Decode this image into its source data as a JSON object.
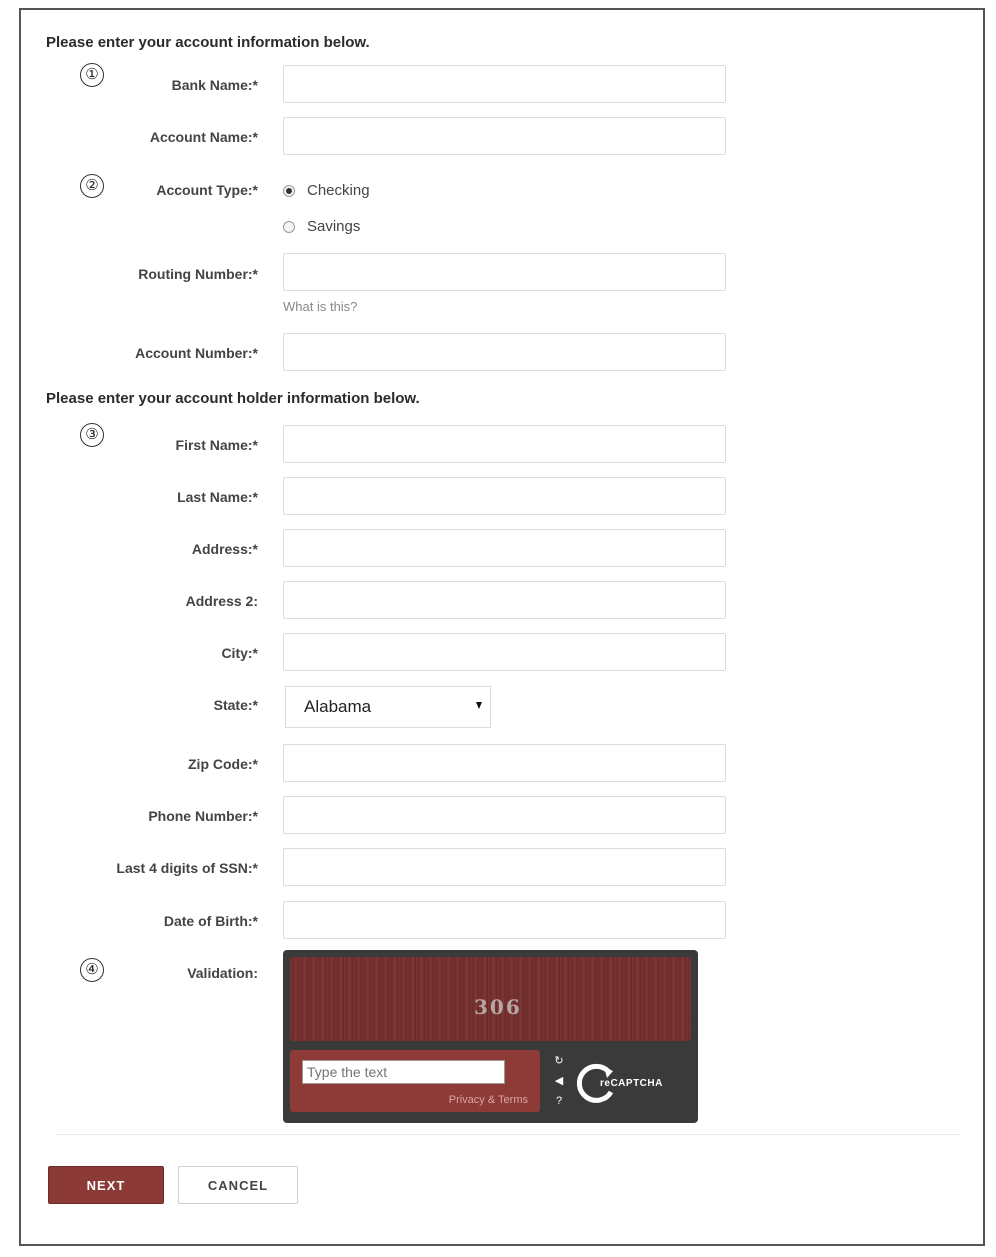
{
  "headings": {
    "account": "Please enter your account information below.",
    "holder": "Please enter your account holder information below."
  },
  "steps": [
    "①",
    "②",
    "③",
    "④"
  ],
  "bank": {
    "bank_name_label": "Bank Name:*",
    "account_name_label": "Account Name:*",
    "account_type_label": "Account Type:*",
    "account_type_options": [
      "Checking",
      "Savings"
    ],
    "account_type_selected": "Checking",
    "routing_label": "Routing Number:*",
    "routing_help": "What is this?",
    "account_number_label": "Account Number:*"
  },
  "holder": {
    "first_name_label": "First Name:*",
    "last_name_label": "Last Name:*",
    "address_label": "Address:*",
    "address2_label": "Address 2:",
    "city_label": "City:*",
    "state_label": "State:*",
    "state_value": "Alabama",
    "zip_label": "Zip Code:*",
    "phone_label": "Phone Number:*",
    "ssn_label": "Last 4 digits of SSN:*",
    "dob_label": "Date of Birth:*",
    "validation_label": "Validation:"
  },
  "captcha": {
    "word": "306",
    "placeholder": "Type the text",
    "terms": "Privacy & Terms",
    "brand": "reCAPTCHA"
  },
  "buttons": {
    "next": "NEXT",
    "cancel": "CANCEL"
  },
  "colors": {
    "accent": "#8b3a36",
    "captcha_bg": "#3a3a3a"
  }
}
